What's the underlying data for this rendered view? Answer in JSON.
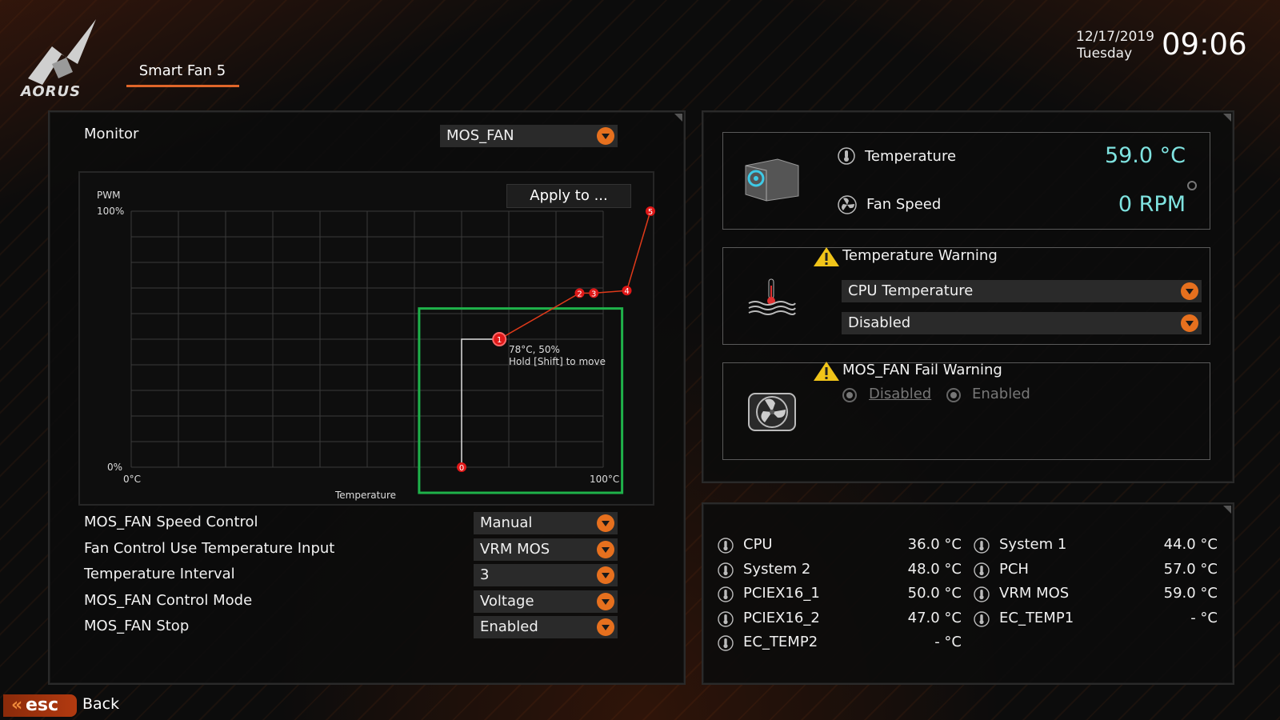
{
  "header": {
    "brand": "AORUS",
    "tab": "Smart Fan 5",
    "date": "12/17/2019",
    "weekday": "Tuesday",
    "time": "09:06"
  },
  "left_panel": {
    "monitor_label": "Monitor",
    "monitor_value": "MOS_FAN",
    "graph": {
      "apply_label": "Apply to ...",
      "y_title": "PWM",
      "y_max": "100%",
      "y_min": "0%",
      "x_min": "0°C",
      "x_max": "100°C",
      "x_title": "Temperature",
      "tooltip_line1": "78°C, 50%",
      "tooltip_line2": "Hold [Shift] to move",
      "points": [
        {
          "label": "0",
          "temp": 70,
          "pwm": 0
        },
        {
          "label": "1",
          "temp": 78,
          "pwm": 50
        },
        {
          "label": "2",
          "temp": 95,
          "pwm": 68
        },
        {
          "label": "3",
          "temp": 98,
          "pwm": 68
        },
        {
          "label": "4",
          "temp": 105,
          "pwm": 69
        },
        {
          "label": "5",
          "temp": 110,
          "pwm": 100
        }
      ],
      "highlight_color": "#1fb24a",
      "point_color": "#e01818"
    },
    "settings": [
      {
        "label": "MOS_FAN Speed Control",
        "value": "Manual"
      },
      {
        "label": "Fan Control Use Temperature Input",
        "value": "VRM MOS"
      },
      {
        "label": "Temperature Interval",
        "value": "3"
      },
      {
        "label": "MOS_FAN Control Mode",
        "value": "Voltage"
      },
      {
        "label": "MOS_FAN Stop",
        "value": "Enabled"
      }
    ]
  },
  "status_panel": {
    "temperature_label": "Temperature",
    "temperature_value": "59.0 °C",
    "fan_speed_label": "Fan Speed",
    "fan_speed_value": "0 RPM",
    "value_color": "#7fe3e0"
  },
  "temp_warning": {
    "title": "Temperature Warning",
    "source": "CPU Temperature",
    "state": "Disabled"
  },
  "fail_warning": {
    "title": "MOS_FAN Fail Warning",
    "option_disabled": "Disabled",
    "option_enabled": "Enabled"
  },
  "sensors": [
    {
      "name": "CPU",
      "value": "36.0 °C"
    },
    {
      "name": "System 1",
      "value": "44.0 °C"
    },
    {
      "name": "System 2",
      "value": "48.0 °C"
    },
    {
      "name": "PCH",
      "value": "57.0 °C"
    },
    {
      "name": "PCIEX16_1",
      "value": "50.0 °C"
    },
    {
      "name": "VRM MOS",
      "value": "59.0 °C"
    },
    {
      "name": "PCIEX16_2",
      "value": "47.0 °C"
    },
    {
      "name": "EC_TEMP1",
      "value": "- °C"
    },
    {
      "name": "EC_TEMP2",
      "value": "- °C"
    }
  ],
  "footer": {
    "esc_label": "esc",
    "back_label": "Back"
  },
  "icons": [
    "aorus-logo",
    "thermometer-icon",
    "fan-icon",
    "warning-icon",
    "pc-case-icon",
    "heat-icon",
    "radio-icon",
    "dropdown-arrow-icon"
  ]
}
